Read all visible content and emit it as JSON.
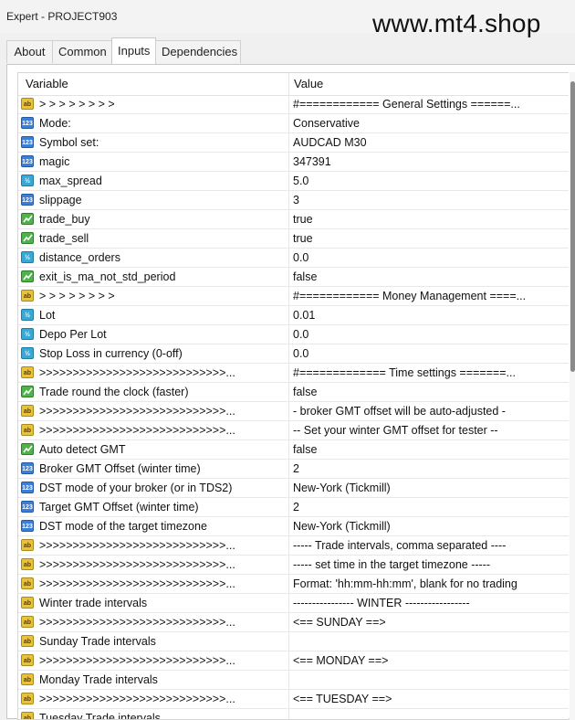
{
  "window": {
    "title": "Expert - PROJECT903",
    "watermark": "www.mt4.shop"
  },
  "tabs": [
    {
      "label": "About",
      "active": false
    },
    {
      "label": "Common",
      "active": false
    },
    {
      "label": "Inputs",
      "active": true
    },
    {
      "label": "Dependencies",
      "active": false
    }
  ],
  "table": {
    "headers": {
      "variable": "Variable",
      "value": "Value"
    },
    "rows": [
      {
        "type": "ab",
        "variable": "> > > > > > > >",
        "value": "#============ General Settings ======..."
      },
      {
        "type": "int",
        "variable": "Mode:",
        "value": "Conservative"
      },
      {
        "type": "int",
        "variable": "Symbol set:",
        "value": "AUDCAD M30"
      },
      {
        "type": "int",
        "variable": "magic",
        "value": "347391"
      },
      {
        "type": "dbl",
        "variable": "max_spread",
        "value": "5.0"
      },
      {
        "type": "int",
        "variable": "slippage",
        "value": "3"
      },
      {
        "type": "bool",
        "variable": "trade_buy",
        "value": "true"
      },
      {
        "type": "bool",
        "variable": "trade_sell",
        "value": "true"
      },
      {
        "type": "dbl",
        "variable": "distance_orders",
        "value": "0.0"
      },
      {
        "type": "bool",
        "variable": "exit_is_ma_not_std_period",
        "value": "false"
      },
      {
        "type": "ab",
        "variable": "> > > > > > > >",
        "value": "#============ Money Management ====..."
      },
      {
        "type": "dbl",
        "variable": "Lot",
        "value": "0.01"
      },
      {
        "type": "dbl",
        "variable": "Depo Per Lot",
        "value": "0.0"
      },
      {
        "type": "dbl",
        "variable": "Stop Loss in currency (0-off)",
        "value": "0.0"
      },
      {
        "type": "ab",
        "variable": ">>>>>>>>>>>>>>>>>>>>>>>>>>>>...",
        "value": "#============= Time settings =======..."
      },
      {
        "type": "bool",
        "variable": "Trade round the clock (faster)",
        "value": "false"
      },
      {
        "type": "ab",
        "variable": ">>>>>>>>>>>>>>>>>>>>>>>>>>>>...",
        "value": "- broker GMT offset will be auto-adjusted -"
      },
      {
        "type": "ab",
        "variable": ">>>>>>>>>>>>>>>>>>>>>>>>>>>>...",
        "value": "-- Set your winter GMT offset for tester --"
      },
      {
        "type": "bool",
        "variable": "Auto detect GMT",
        "value": "false"
      },
      {
        "type": "int",
        "variable": "Broker GMT Offset (winter time)",
        "value": "2"
      },
      {
        "type": "int",
        "variable": "DST mode of your broker (or in TDS2)",
        "value": "New-York (Tickmill)"
      },
      {
        "type": "int",
        "variable": "Target GMT Offset (winter time)",
        "value": "2"
      },
      {
        "type": "int",
        "variable": "DST mode of the target timezone",
        "value": "New-York (Tickmill)"
      },
      {
        "type": "ab",
        "variable": ">>>>>>>>>>>>>>>>>>>>>>>>>>>>...",
        "value": "----- Trade intervals, comma separated ----"
      },
      {
        "type": "ab",
        "variable": ">>>>>>>>>>>>>>>>>>>>>>>>>>>>...",
        "value": "----- set time in the target timezone -----"
      },
      {
        "type": "ab",
        "variable": ">>>>>>>>>>>>>>>>>>>>>>>>>>>>...",
        "value": "Format: 'hh:mm-hh:mm', blank for no trading"
      },
      {
        "type": "ab",
        "variable": "Winter trade intervals",
        "value": "---------------- WINTER -----------------"
      },
      {
        "type": "ab",
        "variable": ">>>>>>>>>>>>>>>>>>>>>>>>>>>>...",
        "value": "<== SUNDAY ==>"
      },
      {
        "type": "ab",
        "variable": "Sunday Trade intervals",
        "value": ""
      },
      {
        "type": "ab",
        "variable": ">>>>>>>>>>>>>>>>>>>>>>>>>>>>...",
        "value": "<== MONDAY ==>"
      },
      {
        "type": "ab",
        "variable": "Monday Trade intervals",
        "value": ""
      },
      {
        "type": "ab",
        "variable": ">>>>>>>>>>>>>>>>>>>>>>>>>>>>...",
        "value": "<== TUESDAY ==>"
      },
      {
        "type": "ab",
        "variable": "Tuesday Trade intervals",
        "value": ""
      }
    ]
  },
  "icons": {
    "ab": "string-type-icon",
    "int": "integer-type-icon",
    "dbl": "double-type-icon",
    "bool": "boolean-type-icon"
  },
  "colors": {
    "accent_tab": "#ffffff",
    "grid_line": "#e8e8e8",
    "string_icon": "#e8c23a",
    "int_icon": "#3b7fd9",
    "double_icon": "#38a9d6",
    "bool_icon": "#4fb24a"
  }
}
